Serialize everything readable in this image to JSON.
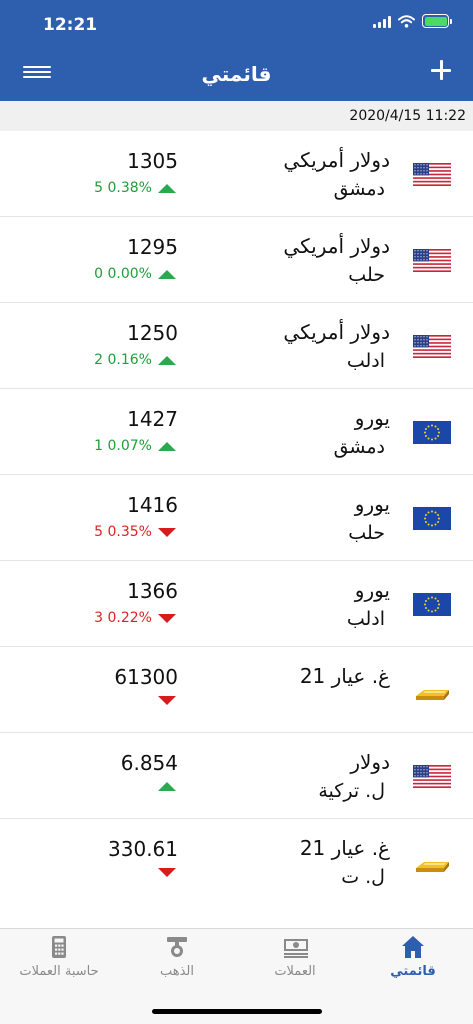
{
  "status_bar": {
    "time": "12:21"
  },
  "header": {
    "title": "قائمتي"
  },
  "last_updated": "2020/4/15 11:22",
  "rows": [
    {
      "value": "1305",
      "change_text": "5 0.38%",
      "direction": "up",
      "name": "دولار أمريكي",
      "city": "دمشق",
      "icon": "us-flag-icon"
    },
    {
      "value": "1295",
      "change_text": "0 0.00%",
      "direction": "up",
      "name": "دولار أمريكي",
      "city": "حلب",
      "icon": "us-flag-icon"
    },
    {
      "value": "1250",
      "change_text": "2 0.16%",
      "direction": "up",
      "name": "دولار أمريكي",
      "city": "ادلب",
      "icon": "us-flag-icon"
    },
    {
      "value": "1427",
      "change_text": "1 0.07%",
      "direction": "up",
      "name": "يورو",
      "city": "دمشق",
      "icon": "eu-flag-icon"
    },
    {
      "value": "1416",
      "change_text": "5 0.35%",
      "direction": "down",
      "name": "يورو",
      "city": "حلب",
      "icon": "eu-flag-icon"
    },
    {
      "value": "1366",
      "change_text": "3 0.22%",
      "direction": "down",
      "name": "يورو",
      "city": "ادلب",
      "icon": "eu-flag-icon"
    },
    {
      "value": "61300",
      "change_text": "",
      "direction": "down",
      "name": "غ. عيار 21",
      "city": "",
      "icon": "gold-bar-icon"
    },
    {
      "value": "6.854",
      "change_text": "",
      "direction": "up",
      "name": "دولار",
      "city": "ل. تركية",
      "icon": "us-flag-icon"
    },
    {
      "value": "330.61",
      "change_text": "",
      "direction": "down",
      "name": "غ. عيار 21",
      "city": "ل. ت",
      "icon": "gold-bar-icon"
    }
  ],
  "tabs": [
    {
      "label": "حاسبة العملات",
      "icon": "calculator-icon",
      "active": false
    },
    {
      "label": "الذهب",
      "icon": "gold-icon",
      "active": false
    },
    {
      "label": "العملات",
      "icon": "banknotes-icon",
      "active": false
    },
    {
      "label": "قائمتي",
      "icon": "home-icon",
      "active": true
    }
  ],
  "colors": {
    "header_bg": "#2e5fae",
    "up": "#1f9e3a",
    "down": "#dd2222",
    "active_tab": "#2e5fae"
  }
}
